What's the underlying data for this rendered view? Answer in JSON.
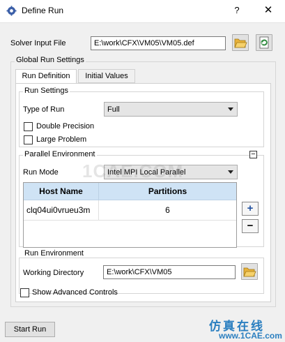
{
  "window": {
    "title": "Define Run",
    "help_label": "?",
    "close_label": "✕",
    "icon": "gear-app-icon"
  },
  "solver_input": {
    "label": "Solver Input File",
    "value": "E:\\work\\CFX\\VM05\\VM05.def",
    "browse_icon": "folder-open-icon",
    "reload_icon": "reload-icon"
  },
  "global_settings": {
    "title": "Global Run Settings",
    "tabs": [
      {
        "label": "Run Definition",
        "active": true
      },
      {
        "label": "Initial Values",
        "active": false
      }
    ]
  },
  "run_settings": {
    "title": "Run Settings",
    "type_label": "Type of Run",
    "type_value": "Full",
    "double_precision_label": "Double Precision",
    "double_precision_checked": false,
    "large_problem_label": "Large Problem",
    "large_problem_checked": false
  },
  "parallel": {
    "title": "Parallel Environment",
    "collapse_label": "−",
    "mode_label": "Run Mode",
    "mode_value": "Intel MPI Local Parallel",
    "table": {
      "headers": [
        "Host Name",
        "Partitions"
      ],
      "rows": [
        {
          "host": "clq04ui0vrueu3m",
          "partitions": "6"
        }
      ]
    },
    "add_label": "+",
    "remove_label": "−"
  },
  "run_env": {
    "title": "Run Environment",
    "dir_label": "Working Directory",
    "dir_value": "E:\\work\\CFX\\VM05",
    "browse_icon": "folder-open-icon"
  },
  "advanced": {
    "label": "Show Advanced Controls",
    "checked": false
  },
  "footer": {
    "start_label": "Start Run"
  },
  "watermark": {
    "text": "1CAE.COM",
    "brand_cn": "仿真在线",
    "brand_en": "www.1CAE.com"
  },
  "colors": {
    "header_bg": "#cfe3f5",
    "folder": "#f2c14e",
    "reload": "#2e8b3d",
    "brand": "#2b7fc0"
  }
}
